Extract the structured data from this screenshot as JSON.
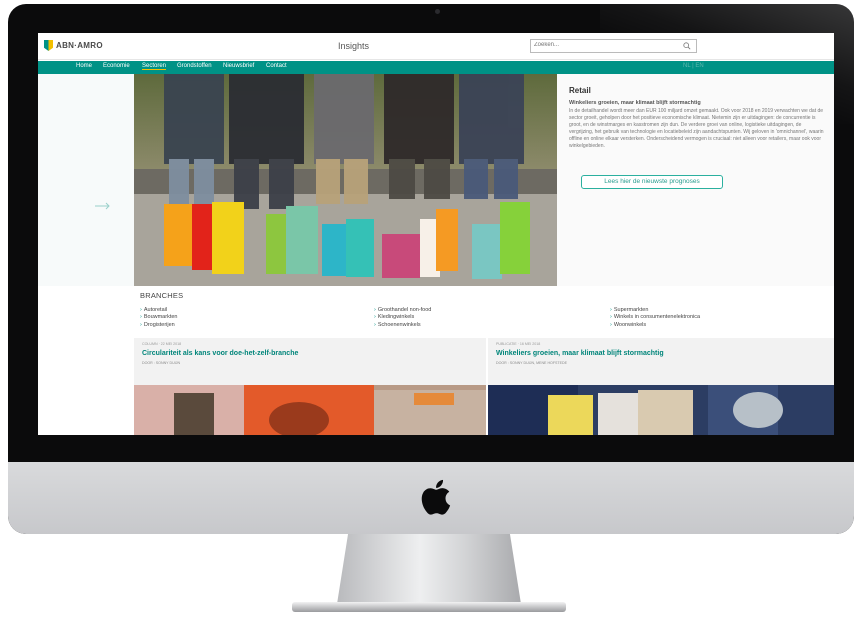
{
  "site": {
    "logo_text": "ABN·AMRO",
    "title": "Insights",
    "search_placeholder": "Zoeken..."
  },
  "nav": {
    "items": [
      "Home",
      "Economie",
      "Sectoren",
      "Grondstoffen",
      "Nieuwsbrief",
      "Contact"
    ],
    "active": "Sectoren",
    "lang": "NL | EN"
  },
  "info": {
    "title": "Retail",
    "subtitle": "Winkeliers groeien, maar klimaat blijft stormachtig",
    "body": "In de detailhandel wordt meer dan EUR 100 miljard omzet gemaakt. Ook voor 2018 en 2019 verwachten we dat de sector groeit, geholpen door het positieve economische klimaat. Nietemin zijn er uitdagingen: de concurrentie is groot, en de winstmarges en kasstromen zijn dun. De verdere groei van online, logistieke uitdagingen, de vergrijzing, het gebruik van technologie en locatiebeleid zijn aandachtspunten. Wij geloven in 'omnichannel', waarin offline en online elkaar versterken. Onderscheidend vermogen is cruciaal: niet alleen voor retailers, maar ook voor winkelgebieden.",
    "cta": "Lees hier de nieuwste prognoses"
  },
  "branches": {
    "title": "BRANCHES",
    "col1": [
      "Autoretail",
      "Bouwmarkten",
      "Drogisterijen"
    ],
    "col2": [
      "Groothandel non-food",
      "Kledingwinkels",
      "Schoenenwinkels"
    ],
    "col3": [
      "Supermarkten",
      "Winkels in consumentenelektronica",
      "Woonwinkels"
    ]
  },
  "cards": [
    {
      "meta": "COLUMN · 22 MEI 2018",
      "title": "Circulariteit als kans voor doe-het-zelf-branche",
      "author": "DOOR : SONNY DUIJN"
    },
    {
      "meta": "PUBLICATIE · 16 MEI 2018",
      "title": "Winkeliers groeien, maar klimaat blijft stormachtig",
      "author": "DOOR : SONNY DUIJN, MENE HOFSTEDE"
    }
  ],
  "colors": {
    "brand_green": "#009286",
    "brand_yellow": "#f3c000",
    "link_green": "#00857a"
  },
  "icons": [
    "search-icon",
    "arrow-right-icon",
    "apple-logo"
  ]
}
